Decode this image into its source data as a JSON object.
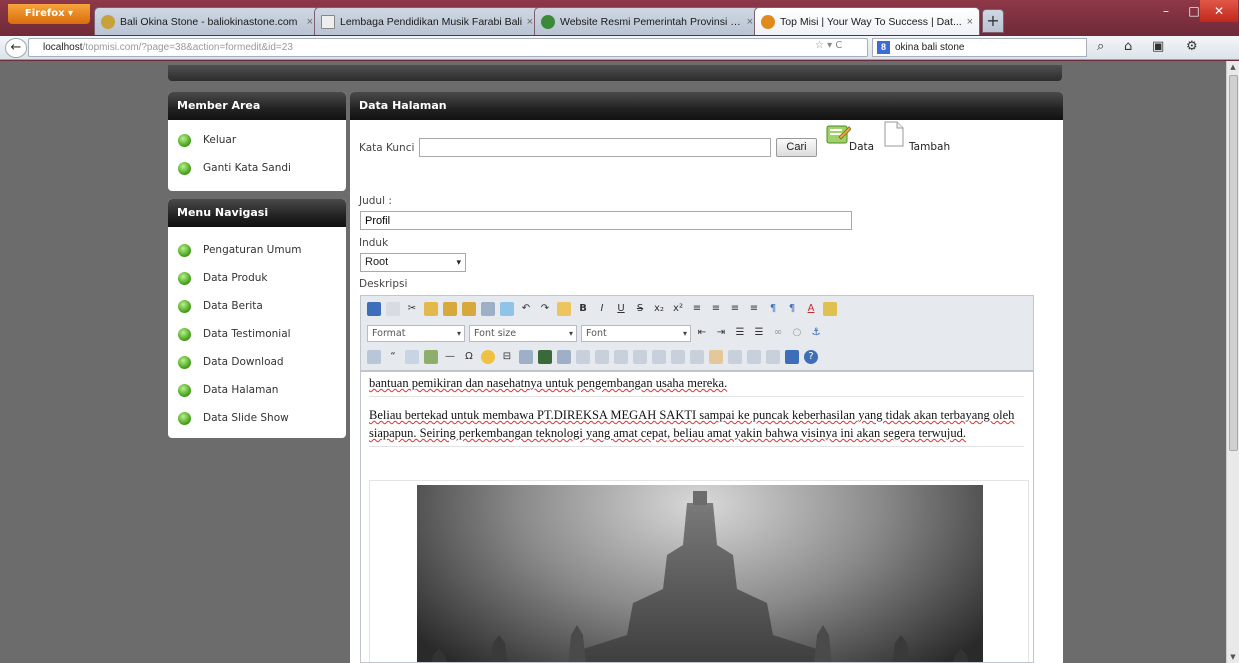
{
  "browser": {
    "firefox_label": "Firefox ▾",
    "tabs": [
      {
        "title": "Bali Okina Stone - baliokinastone.com",
        "fav_color": "#c7a23a"
      },
      {
        "title": "Lembaga Pendidikan Musik Farabi Bali",
        "fav_color": "#eeeeee"
      },
      {
        "title": "Website Resmi Pemerintah Provinsi B...",
        "fav_color": "#3a8a3a"
      },
      {
        "title": "Top Misi | Your Way To Success | Dat...",
        "fav_color": "#e08a1e"
      }
    ],
    "new_tab": "+",
    "url_host": "localhost",
    "url_rest": "/topmisi.com/?page=38&action=formedit&id=23",
    "search_engine_letter": "8",
    "search_text": "okina bali stone"
  },
  "sidebar": {
    "member_area": {
      "title": "Member Area",
      "items": [
        "Keluar",
        "Ganti Kata Sandi"
      ]
    },
    "menu_navigasi": {
      "title": "Menu Navigasi",
      "items": [
        "Pengaturan Umum",
        "Data Produk",
        "Data Berita",
        "Data Testimonial",
        "Data Download",
        "Data Halaman",
        "Data Slide Show"
      ]
    }
  },
  "main": {
    "title": "Data Halaman",
    "search_label": "Kata Kunci",
    "search_value": "",
    "search_button": "Cari",
    "data_link": "Data",
    "tambah_link": "Tambah",
    "judul_label": "Judul :",
    "judul_value": "Profil",
    "induk_label": "Induk",
    "induk_value": "Root",
    "deskripsi_label": "Deskripsi",
    "editor": {
      "format_combo": "Format",
      "fontsize_combo": "Font size",
      "font_combo": "Font",
      "para1": "bantuan pemikiran dan nasehatnya untuk pengembangan usaha mereka.",
      "para2": "Beliau bertekad untuk membawa PT.DIREKSA MEGAH SAKTI sampai ke puncak keberhasilan yang tidak akan terbayang oleh siapapun. Seiring perkembangan teknologi yang amat cepat, beliau amat yakin bahwa visinya ini akan segera terwujud."
    }
  },
  "colors": {
    "accent_green": "#3f9a12",
    "header_dark": "#1e1e1e",
    "page_bg": "#6c6c6c"
  }
}
